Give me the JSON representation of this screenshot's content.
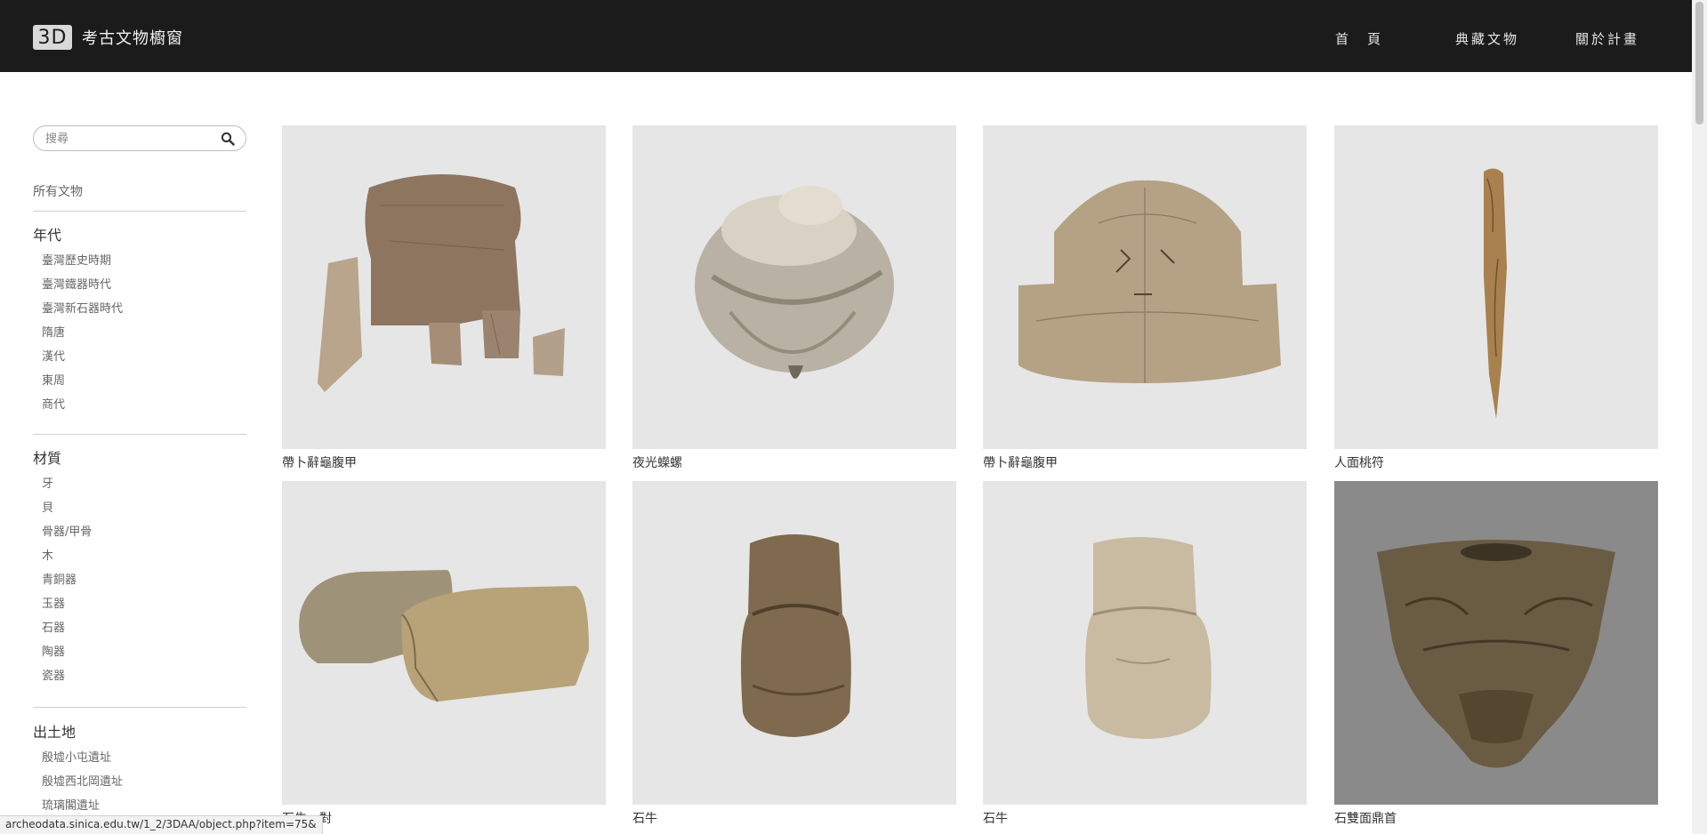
{
  "header": {
    "logo_badge": "3D",
    "logo_text": "考古文物櫥窗",
    "nav": [
      {
        "label": "首　頁"
      },
      {
        "label": "典藏文物"
      },
      {
        "label": "關於計畫"
      }
    ]
  },
  "sidebar": {
    "search_placeholder": "搜尋",
    "search_icon": "search-icon",
    "all_label": "所有文物",
    "categories": [
      {
        "title": "年代",
        "items": [
          "臺灣歷史時期",
          "臺灣鐵器時代",
          "臺灣新石器時代",
          "隋唐",
          "漢代",
          "東周",
          "商代"
        ]
      },
      {
        "title": "材質",
        "items": [
          "牙",
          "貝",
          "骨器/甲骨",
          "木",
          "青銅器",
          "玉器",
          "石器",
          "陶器",
          "瓷器"
        ]
      },
      {
        "title": "出土地",
        "items": [
          "殷墟小屯遺址",
          "殷墟西北岡遺址",
          "琉璃閣遺址"
        ]
      }
    ]
  },
  "grid": [
    {
      "caption": "帶卜辭龜腹甲",
      "bg": "#e6e6e6"
    },
    {
      "caption": "夜光蠑螺",
      "bg": "#e6e6e6"
    },
    {
      "caption": "帶卜辭龜腹甲",
      "bg": "#e6e6e6"
    },
    {
      "caption": "人面桃符",
      "bg": "#e6e6e6"
    },
    {
      "caption": "石牛一對",
      "bg": "#e6e6e6"
    },
    {
      "caption": "石牛",
      "bg": "#e6e6e6"
    },
    {
      "caption": "石牛",
      "bg": "#e6e6e6"
    },
    {
      "caption": "石雙面鼎首",
      "bg": "#8a8a8a"
    }
  ],
  "status": {
    "url": "archeodata.sinica.edu.tw/1_2/3DAA/object.php?item=75&"
  }
}
